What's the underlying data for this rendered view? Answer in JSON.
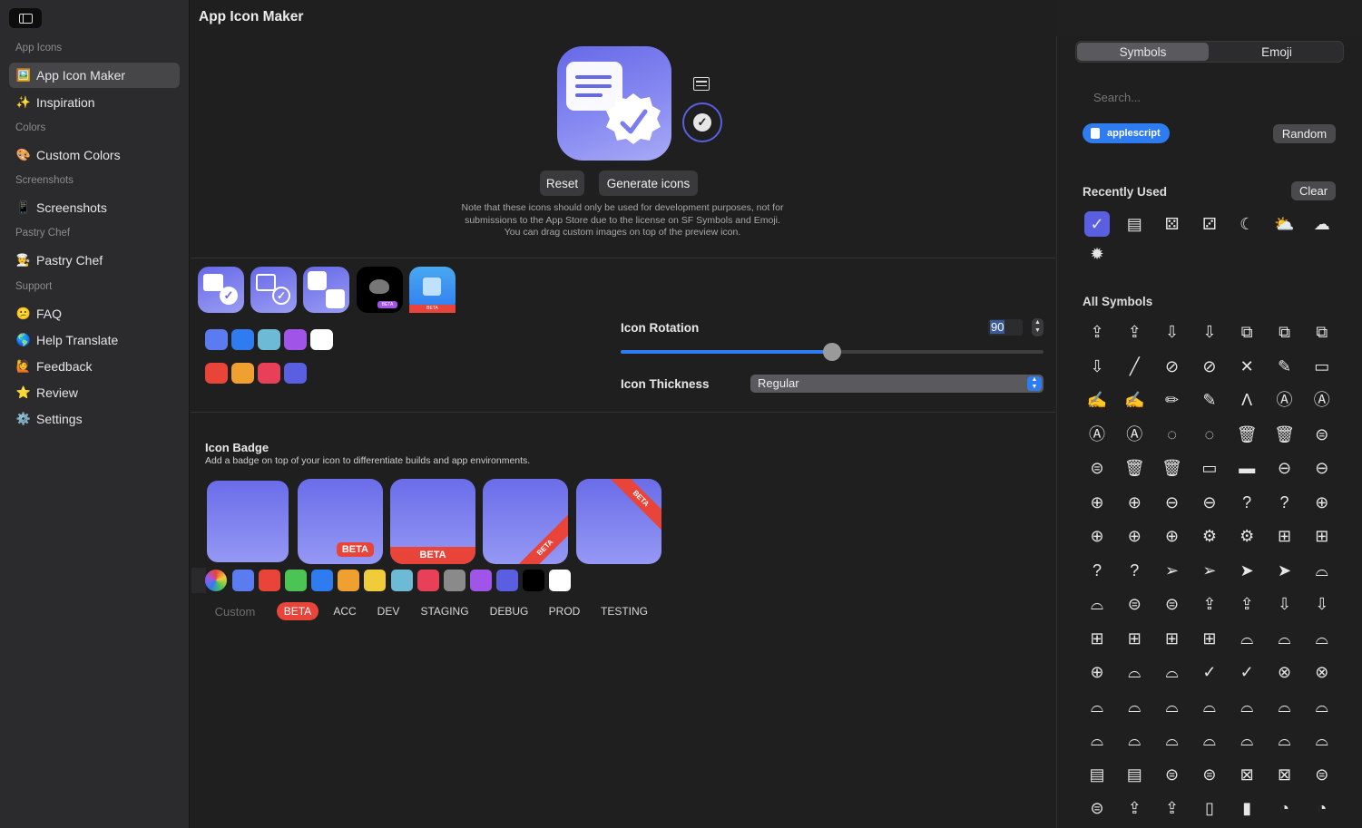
{
  "sidebar": {
    "sections": [
      {
        "label": "App Icons",
        "items": [
          {
            "label": "App Icon Maker",
            "icon": "🖼️",
            "selected": true
          },
          {
            "label": "Inspiration",
            "icon": "✨"
          }
        ]
      },
      {
        "label": "Colors",
        "items": [
          {
            "label": "Custom Colors",
            "icon": "🎨"
          }
        ]
      },
      {
        "label": "Screenshots",
        "items": [
          {
            "label": "Screenshots",
            "icon": "📱"
          }
        ]
      },
      {
        "label": "Pastry Chef",
        "items": [
          {
            "label": "Pastry Chef",
            "icon": "🧑‍🍳"
          }
        ]
      },
      {
        "label": "Support",
        "items": [
          {
            "label": "FAQ",
            "icon": "😕"
          },
          {
            "label": "Help Translate",
            "icon": "🌎"
          },
          {
            "label": "Feedback",
            "icon": "🙋"
          },
          {
            "label": "Review",
            "icon": "⭐"
          },
          {
            "label": "Settings",
            "icon": "⚙️"
          }
        ]
      }
    ]
  },
  "header": {
    "title": "App Icon Maker"
  },
  "preview": {
    "reset_label": "Reset",
    "generate_label": "Generate icons",
    "note_lines": [
      "Note that these icons should only be used for development purposes, not for",
      "submissions to the App Store due to the license on SF Symbols and Emoji.",
      "You can drag custom images on top of the preview icon."
    ]
  },
  "presets": {
    "badge_text": "BETA"
  },
  "background_colors": [
    "#5b7cf0",
    "#2f7cf0",
    "#6cbad6",
    "#a055e8",
    "#ffffff",
    "#e8443a",
    "#f0a030",
    "#e84058",
    "#5a5ee0"
  ],
  "controls": {
    "rotation_label": "Icon Rotation",
    "rotation_value": "90",
    "rotation_fraction": 0.5,
    "thickness_label": "Icon Thickness",
    "thickness_value": "Regular"
  },
  "badge": {
    "title": "Icon Badge",
    "subtitle": "Add a badge on top of your icon to differentiate builds and app environments.",
    "badge_text": "BETA",
    "colors": [
      "#5b7cf0",
      "#e8443a",
      "#4cc455",
      "#2f7cf0",
      "#f0a030",
      "#f0cc3a",
      "#6cbad6",
      "#e84058",
      "#8a8a8a",
      "#a055e8",
      "#5a5ee0",
      "#000000",
      "#ffffff"
    ],
    "environments": [
      "Custom",
      "BETA",
      "ACC",
      "DEV",
      "STAGING",
      "DEBUG",
      "PROD",
      "TESTING"
    ],
    "selected_environment": "BETA"
  },
  "symbols_panel": {
    "tabs": [
      "Symbols",
      "Emoji"
    ],
    "selected_tab": "Symbols",
    "search_placeholder": "Search...",
    "current_symbol": "applescript",
    "random_label": "Random",
    "recently_used_label": "Recently Used",
    "clear_label": "Clear",
    "all_symbols_label": "All Symbols",
    "recent_icons": [
      "checkmark-seal-icon",
      "doc-text-icon",
      "die-five-icon",
      "die-three-icon",
      "moon-icon",
      "sun-cloud-icon",
      "cloud-icon",
      "sun-icon"
    ],
    "recent_glyphs": [
      "✓",
      "▤",
      "⚄",
      "⚂",
      "☾",
      "⛅",
      "☁",
      "✹"
    ],
    "all_glyphs": [
      "⇪",
      "⇪",
      "⇩",
      "⇩",
      "⧉",
      "⧉",
      "⧉",
      "⇩",
      "╱",
      "⊘",
      "⊘",
      "✕",
      "✎",
      "▭",
      "✍",
      "✍",
      "✏",
      "✎",
      "Λ",
      "Ⓐ",
      "Ⓐ",
      "Ⓐ",
      "Ⓐ",
      "◌",
      "◌",
      "🗑",
      "🗑",
      "⊜",
      "⊜",
      "🗑",
      "🗑",
      "▭",
      "▬",
      "⊖",
      "⊖",
      "⊕",
      "⊕",
      "⊖",
      "⊖",
      "?",
      "?",
      "⊕",
      "⊕",
      "⊕",
      "⊕",
      "⚙",
      "⚙",
      "⊞",
      "⊞",
      "?",
      "?",
      "➢",
      "➢",
      "➤",
      "➤",
      "⌓",
      "⌓",
      "⊜",
      "⊜",
      "⇪",
      "⇪",
      "⇩",
      "⇩",
      "⊞",
      "⊞",
      "⊞",
      "⊞",
      "⌓",
      "⌓",
      "⌓",
      "⊕",
      "⌓",
      "⌓",
      "✓",
      "✓",
      "⊗",
      "⊗",
      "⌓",
      "⌓",
      "⌓",
      "⌓",
      "⌓",
      "⌓",
      "⌓",
      "⌓",
      "⌓",
      "⌓",
      "⌓",
      "⌓",
      "⌓",
      "⌓",
      "▤",
      "▤",
      "⊜",
      "⊜",
      "⊠",
      "⊠",
      "⊜",
      "⊜",
      "⇪",
      "⇪",
      "▯",
      "▮",
      "◔",
      "◔"
    ]
  }
}
